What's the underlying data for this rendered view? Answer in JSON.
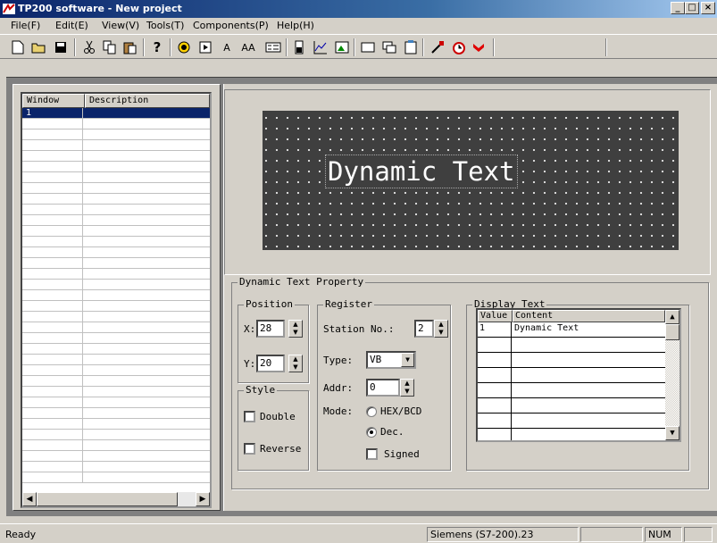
{
  "window": {
    "title": "TP200 software - New project",
    "controls": {
      "minimize": "_",
      "maximize": "□",
      "close": "×"
    }
  },
  "menu": [
    "File(F)",
    "Edit(E)",
    "View(V)",
    "Tools(T)",
    "Components(P)",
    "Help(H)"
  ],
  "toolbar": {
    "text_label": "A",
    "text_aa_label": "AA"
  },
  "window_list": {
    "columns": [
      "Window",
      "Description"
    ],
    "rows": [
      {
        "window": "1",
        "description": ""
      }
    ],
    "selected_index": 0
  },
  "preview": {
    "dynamic_text": "Dynamic Text",
    "screen_bg": "#3f3f3f"
  },
  "property": {
    "title": "Dynamic Text Property",
    "position": {
      "title": "Position",
      "x_label": "X:",
      "x": "28",
      "y_label": "Y:",
      "y": "20"
    },
    "style": {
      "title": "Style",
      "double_label": "Double",
      "double": false,
      "reverse_label": "Reverse",
      "reverse": false
    },
    "register": {
      "title": "Register",
      "station_label": "Station No.:",
      "station": "2",
      "type_label": "Type:",
      "type": "VB",
      "addr_label": "Addr:",
      "addr": "0",
      "mode_label": "Mode:",
      "mode_hex": "HEX/BCD",
      "mode_dec": "Dec.",
      "mode_selected": "dec",
      "signed_label": "Signed",
      "signed": false
    },
    "display_text": {
      "title": "Display Text",
      "columns": [
        "Value",
        "Content"
      ],
      "rows": [
        {
          "value": "1",
          "content": "Dynamic Text"
        }
      ]
    }
  },
  "status": {
    "ready": "Ready",
    "plc": "Siemens (S7-200).23",
    "num": "NUM"
  }
}
